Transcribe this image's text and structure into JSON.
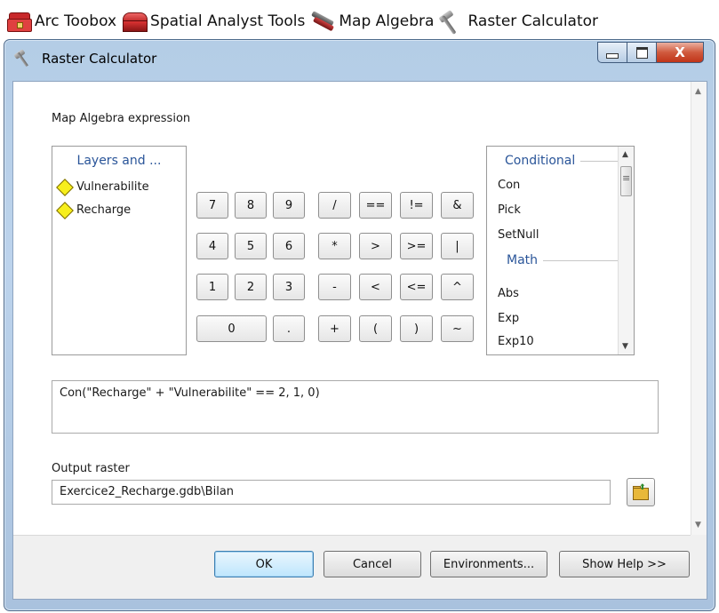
{
  "breadcrumb": [
    {
      "label": "Arc Toobox",
      "icon": "toolbox-icon"
    },
    {
      "label": "Spatial Analyst Tools",
      "icon": "toolbox-red-icon"
    },
    {
      "label": "Map Algebra",
      "icon": "tools-icon"
    },
    {
      "label": "Raster Calculator",
      "icon": "hammer-icon"
    }
  ],
  "window": {
    "title": "Raster Calculator",
    "close_glyph": "X"
  },
  "dialog": {
    "expression_label": "Map Algebra expression",
    "layers_header": "Layers and ...",
    "layers": [
      "Vulnerabilite",
      "Recharge"
    ],
    "keypad": [
      "7",
      "8",
      "9",
      "/",
      "==",
      "!=",
      "&",
      "4",
      "5",
      "6",
      "*",
      ">",
      ">=",
      "|",
      "1",
      "2",
      "3",
      "-",
      "<",
      "<=",
      "^",
      "0",
      ".",
      "+",
      "(",
      ")",
      "~"
    ],
    "functions": {
      "sections": [
        "Conditional",
        "Math"
      ],
      "conditional": [
        "Con",
        "Pick",
        "SetNull"
      ],
      "math": [
        "Abs",
        "Exp",
        "Exp10"
      ]
    },
    "expression": "Con(\"Recharge\" + \"Vulnerabilite\" == 2, 1, 0)",
    "output_label": "Output raster",
    "output_value": "Exercice2_Recharge.gdb\\Bilan"
  },
  "buttons": {
    "ok": "OK",
    "cancel": "Cancel",
    "environments": "Environments...",
    "show_help": "Show Help >>"
  },
  "colors": {
    "window_frame": "#b9d1ea",
    "section_header": "#2a5599",
    "layer_symbol": "#f7ef1c",
    "close_button": "#c8402a"
  }
}
